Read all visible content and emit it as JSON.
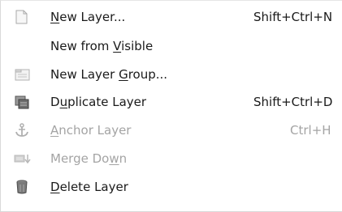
{
  "menu": {
    "items": [
      {
        "pre": "",
        "mn": "N",
        "post": "ew Layer...",
        "shortcut": "Shift+Ctrl+N",
        "icon": "new-layer-icon",
        "enabled": true
      },
      {
        "pre": "New from ",
        "mn": "V",
        "post": "isible",
        "shortcut": "",
        "icon": "",
        "enabled": true
      },
      {
        "pre": "New Layer ",
        "mn": "G",
        "post": "roup...",
        "shortcut": "",
        "icon": "layer-group-icon",
        "enabled": true
      },
      {
        "pre": "D",
        "mn": "u",
        "post": "plicate Layer",
        "shortcut": "Shift+Ctrl+D",
        "icon": "duplicate-layer-icon",
        "enabled": true
      },
      {
        "pre": "",
        "mn": "A",
        "post": "nchor Layer",
        "shortcut": "Ctrl+H",
        "icon": "anchor-icon",
        "enabled": false
      },
      {
        "pre": "Merge Do",
        "mn": "w",
        "post": "n",
        "shortcut": "",
        "icon": "merge-down-icon",
        "enabled": false
      },
      {
        "pre": "",
        "mn": "D",
        "post": "elete Layer",
        "shortcut": "",
        "icon": "trash-icon",
        "enabled": true
      }
    ]
  },
  "colors": {
    "text": "#1a1a1a",
    "disabled_text": "#a4a4a4",
    "icon": "#6e6e6e",
    "background": "#ffffff"
  }
}
